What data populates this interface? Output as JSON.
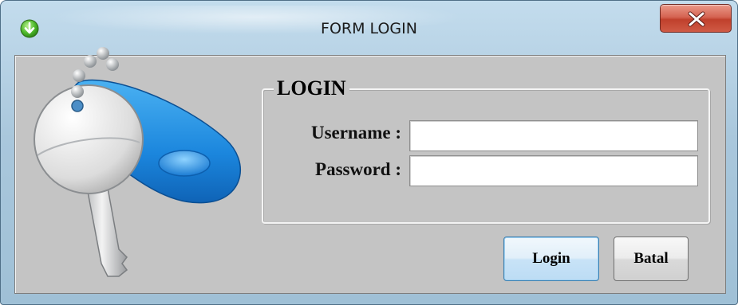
{
  "window": {
    "title": "FORM LOGIN",
    "app_icon": "green-down-arrow-icon",
    "close_glyph": "x"
  },
  "key_image": "key-icon",
  "group": {
    "legend": "LOGIN",
    "username_label": "Username :",
    "password_label": "Password :",
    "username_value": "",
    "password_value": ""
  },
  "buttons": {
    "login": "Login",
    "batal": "Batal"
  },
  "colors": {
    "client_background": "#c4c4c4",
    "close_button": "#c9483a",
    "login_button_border": "#3c7fb1",
    "key_tag_blue": "#1e8fe0"
  }
}
